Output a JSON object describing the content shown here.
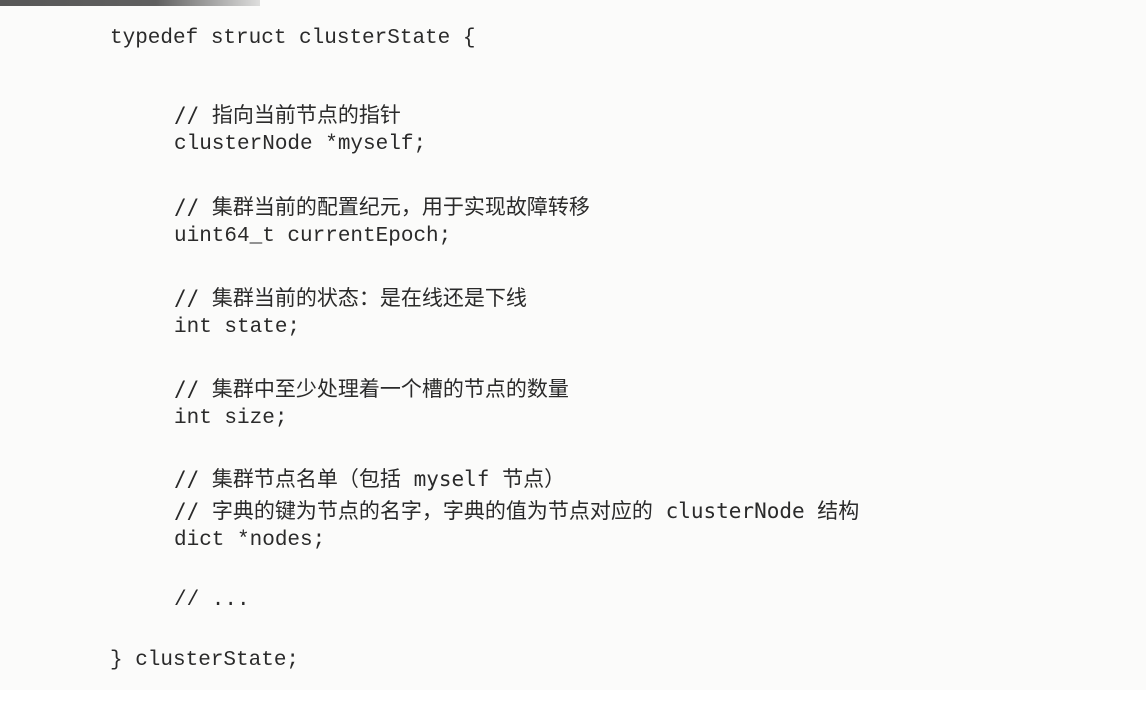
{
  "code": {
    "line_struct_open": "typedef struct clusterState {",
    "comment_myself": "// 指向当前节点的指针",
    "line_myself": "clusterNode *myself;",
    "comment_epoch": "// 集群当前的配置纪元，用于实现故障转移",
    "line_epoch": "uint64_t currentEpoch;",
    "comment_state": "// 集群当前的状态：是在线还是下线",
    "line_state": "int state;",
    "comment_size": "// 集群中至少处理着一个槽的节点的数量",
    "line_size": "int size;",
    "comment_nodes_1": "// 集群节点名单（包括 myself 节点）",
    "comment_nodes_2": "// 字典的键为节点的名字，字典的值为节点对应的 clusterNode 结构",
    "line_nodes": "dict *nodes;",
    "comment_ellipsis": "// ...",
    "line_struct_close": "} clusterState;"
  }
}
